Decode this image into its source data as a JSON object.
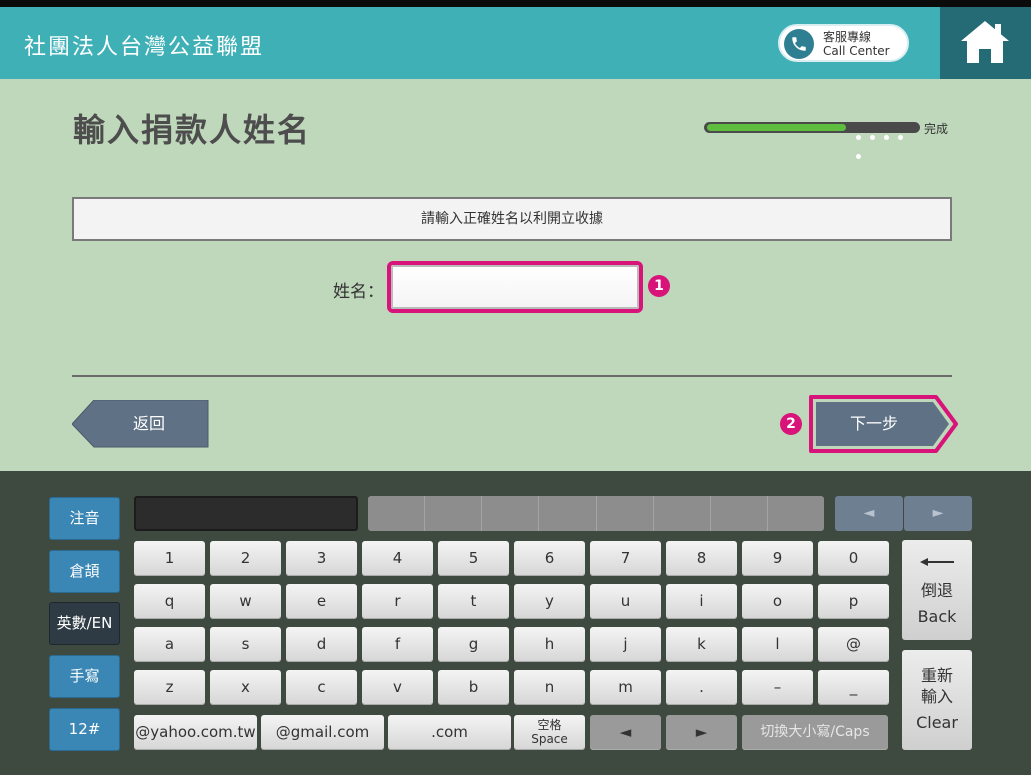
{
  "header": {
    "org_name": "社團法人台灣公益聯盟",
    "call_center_line1": "客服專線",
    "call_center_line2": "Call Center",
    "home_icon": "home-icon",
    "phone_icon": "phone-icon"
  },
  "main": {
    "page_title": "輸入捐款人姓名",
    "progress_label": "完成",
    "progress_fraction": 0.66,
    "hint": "請輸入正確姓名以利開立收據",
    "name_label": "姓名：",
    "name_value": "",
    "badge_1": "1",
    "badge_2": "2",
    "back_label": "返回",
    "next_label": "下一步"
  },
  "keyboard": {
    "modes": [
      "注音",
      "倉頡",
      "英數/EN",
      "手寫",
      "12#"
    ],
    "active_mode": "英數/EN",
    "prev_arrow": "◄",
    "next_arrow": "►",
    "rows": [
      [
        "1",
        "2",
        "3",
        "4",
        "5",
        "6",
        "7",
        "8",
        "9",
        "0"
      ],
      [
        "q",
        "w",
        "e",
        "r",
        "t",
        "y",
        "u",
        "i",
        "o",
        "p"
      ],
      [
        "a",
        "s",
        "d",
        "f",
        "g",
        "h",
        "j",
        "k",
        "l",
        "@"
      ],
      [
        "z",
        "x",
        "c",
        "v",
        "b",
        "n",
        "m",
        ".",
        "–",
        "_"
      ]
    ],
    "bottom": {
      "yahoo": "@yahoo.com.tw",
      "gmail": "@gmail.com",
      "com": ".com",
      "space_top": "空格",
      "space_bottom": "Space",
      "left": "◄",
      "right": "►",
      "caps": "切換大小寫/Caps"
    },
    "backspace_line1": "倒退",
    "backspace_line2": "Back",
    "clear_line1": "重新",
    "clear_line2": "輸入",
    "clear_line3": "Clear"
  },
  "colors": {
    "header": "#3fb0b6",
    "home_box": "#256b75",
    "background": "#bfd8bb",
    "highlight": "#d8137a",
    "keyboard_bg": "#3e4940",
    "mode_button": "#3a87b5",
    "progress": "#5fbd3f"
  }
}
